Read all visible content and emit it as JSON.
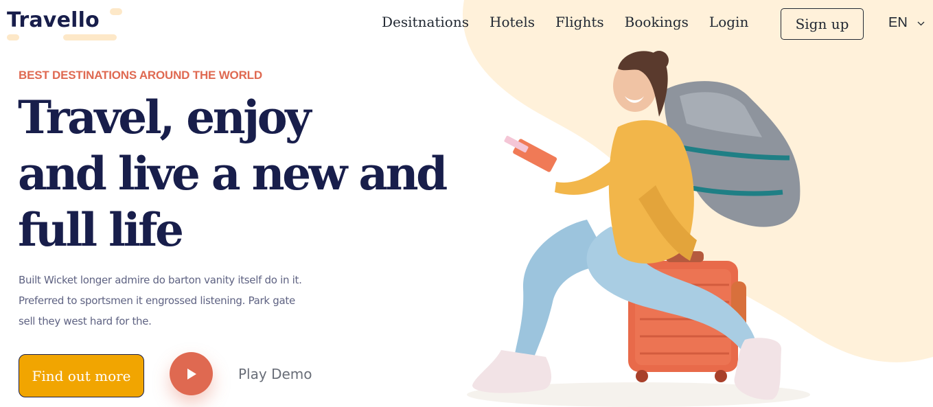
{
  "brand": {
    "logo_text": "Travello"
  },
  "nav": {
    "links": [
      "Desitnations",
      "Hotels",
      "Flights",
      "Bookings",
      "Login"
    ],
    "signup_label": "Sign up",
    "language": "EN"
  },
  "hero": {
    "eyebrow": "BEST DESTINATIONS AROUND THE WORLD",
    "headline_lines": [
      "Travel, enjoy",
      "and live a new and",
      "full life"
    ],
    "description_lines": [
      "Built Wicket longer admire do barton vanity itself do in it.",
      "Preferred to sportsmen it engrossed listening. Park gate",
      "sell they west hard for the."
    ],
    "cta_label": "Find out more",
    "play_label": "Play Demo"
  },
  "colors": {
    "accent": "#df6951",
    "cta": "#f1a501",
    "heading": "#181e4b",
    "blob": "#fff1da"
  },
  "icons": {
    "play": "play-icon",
    "chevron": "chevron-down-icon"
  }
}
